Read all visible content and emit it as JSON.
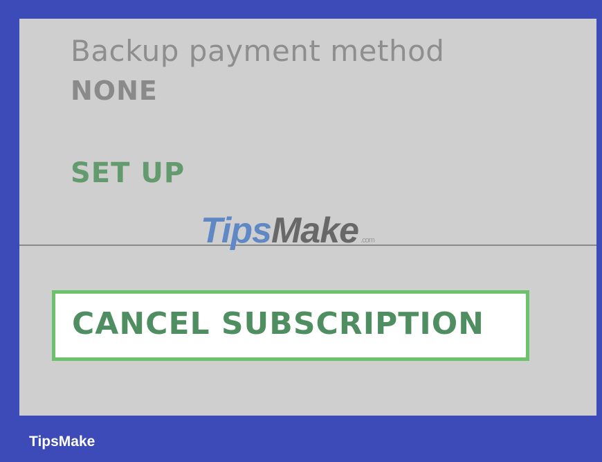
{
  "subscription": {
    "backup_label": "Backup payment method",
    "backup_value": "NONE",
    "setup_label": "SET UP",
    "cancel_label": "CANCEL SUBSCRIPTION"
  },
  "watermark": {
    "part1": "Tips",
    "part2": "Make",
    "suffix": ".com"
  },
  "footer": {
    "brand": "TipsMake"
  },
  "colors": {
    "frame_border": "#3d4bb8",
    "panel_bg": "#cfcfcf",
    "accent_green": "#639a6e",
    "highlight_border": "#6cc26a"
  }
}
